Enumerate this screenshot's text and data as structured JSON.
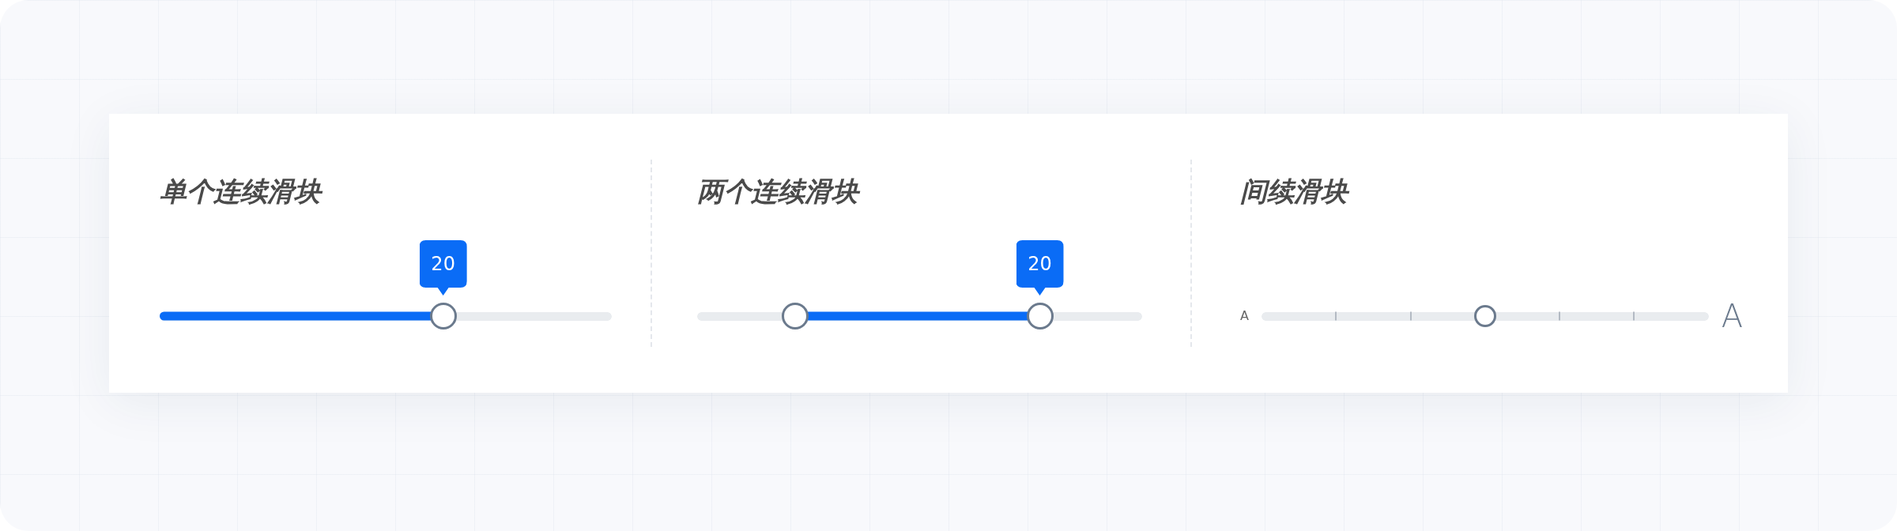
{
  "sliders": [
    {
      "kind": "single",
      "title": "单个连续滑块",
      "handles": [
        {
          "level": 0.627,
          "tooltip": "20"
        }
      ]
    },
    {
      "kind": "range",
      "title": "两个连续滑块",
      "handles": [
        {
          "level": 0.22
        },
        {
          "level": 0.77,
          "tooltip": "20"
        }
      ]
    },
    {
      "kind": "stepped",
      "title": "间续滑块",
      "min_label": "A",
      "max_label": "A",
      "handles": [
        {
          "level": 0.5
        }
      ]
    }
  ]
}
